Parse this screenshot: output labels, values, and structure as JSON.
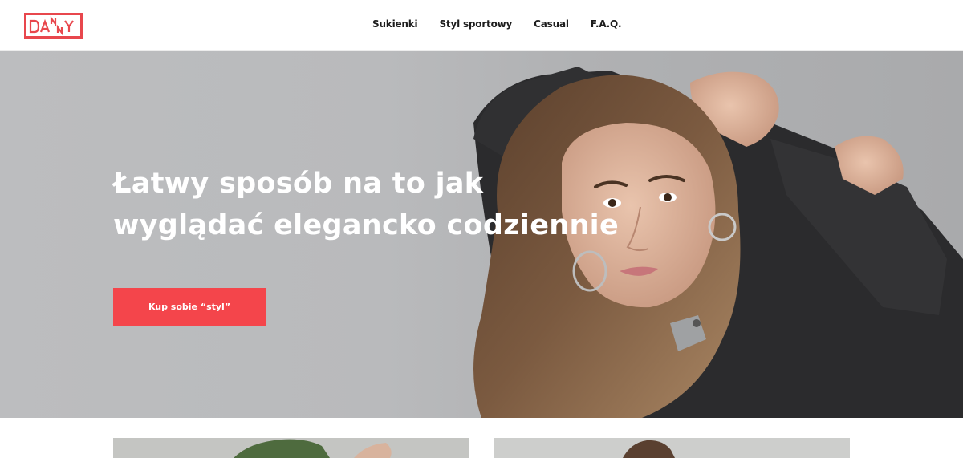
{
  "brand": {
    "logo_text": "DANNY",
    "accent_color": "#e8474d"
  },
  "nav": {
    "items": [
      {
        "label": "Sukienki"
      },
      {
        "label": "Styl sportowy"
      },
      {
        "label": "Casual"
      },
      {
        "label": "F.A.Q."
      }
    ]
  },
  "hero": {
    "title_line1": "Łatwy sposób na to jak",
    "title_line2": "wyglądać elegancko codziennie",
    "cta_label": "Kup sobie “styl”",
    "cta_color": "#f4454b",
    "photo_icon": "woman-portrait-photo"
  },
  "cards": [
    {
      "icon": "product-photo-green-jacket"
    },
    {
      "icon": "product-photo-model"
    }
  ]
}
